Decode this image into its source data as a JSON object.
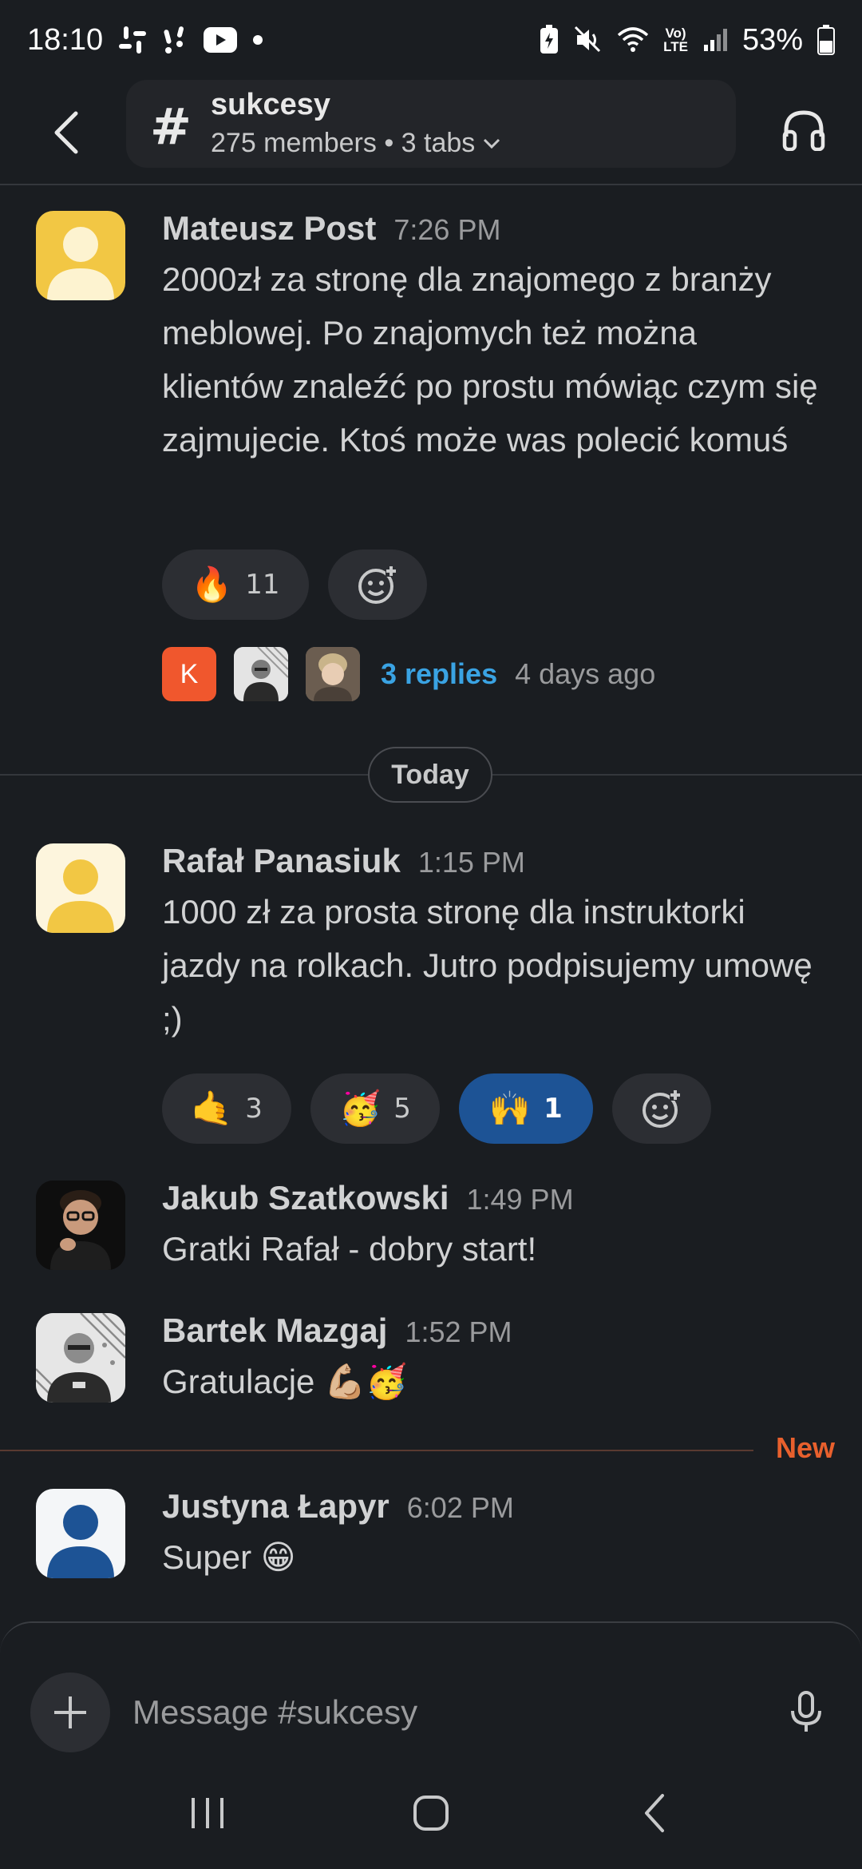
{
  "status_bar": {
    "time": "18:10",
    "battery": "53%",
    "icons": [
      "slack-icon",
      "notification-icon",
      "youtube-icon",
      "dot-icon",
      "battery-saver-icon",
      "mute-icon",
      "wifi-icon",
      "volte-icon",
      "signal-icon",
      "battery-icon"
    ],
    "network_label_top": "Vo)",
    "network_label_bottom": "LTE"
  },
  "header": {
    "channel_prefix": "#",
    "channel_name": "sukcesy",
    "meta": "275 members • 3 tabs"
  },
  "messages": [
    {
      "author": "Mateusz Post",
      "time": "7:26 PM",
      "text": "2000zł za stronę dla znajomego z branży meblowej. Po znajomych też można klientów znaleźć po prostu mówiąc czym się zajmujecie. Ktoś może was polecić komuś",
      "avatar_colors": {
        "bg": "#f2c744",
        "fg": "#fdf3d0"
      },
      "reactions": [
        {
          "emoji": "🔥",
          "count": "11"
        }
      ],
      "thread": {
        "avatars": [
          {
            "letter": "K",
            "bg": "#f0572d"
          }
        ],
        "replies": "3 replies",
        "last_reply": "4 days ago"
      }
    },
    {
      "author": "Rafał Panasiuk",
      "time": "1:15 PM",
      "text": "1000 zł za prosta stronę dla instruktorki jazdy na rolkach. Jutro podpisujemy umowę ;)",
      "avatar_colors": {
        "bg": "#fdf5dd",
        "fg": "#f2c744"
      },
      "reactions": [
        {
          "emoji": "🤙",
          "count": "3"
        },
        {
          "emoji": "🥳",
          "count": "5"
        },
        {
          "emoji": "🙌",
          "count": "1"
        }
      ]
    },
    {
      "author": "Jakub Szatkowski",
      "time": "1:49 PM",
      "text": "Gratki Rafał - dobry start!"
    },
    {
      "author": "Bartek Mazgaj",
      "time": "1:52 PM",
      "text": "Gratulacje 💪🏼🥳"
    },
    {
      "author": "Justyna Łapyr",
      "time": "6:02 PM",
      "text": "Super 😁",
      "avatar_colors": {
        "bg": "#f4f6f8",
        "fg": "#1d5395"
      }
    }
  ],
  "dividers": {
    "day": "Today",
    "new": "New"
  },
  "composer": {
    "placeholder": "Message #sukcesy"
  },
  "colors": {
    "background": "#1a1d21",
    "link": "#3aa3e3",
    "new_accent": "#e8602d",
    "active_reaction": "#1d5395"
  }
}
